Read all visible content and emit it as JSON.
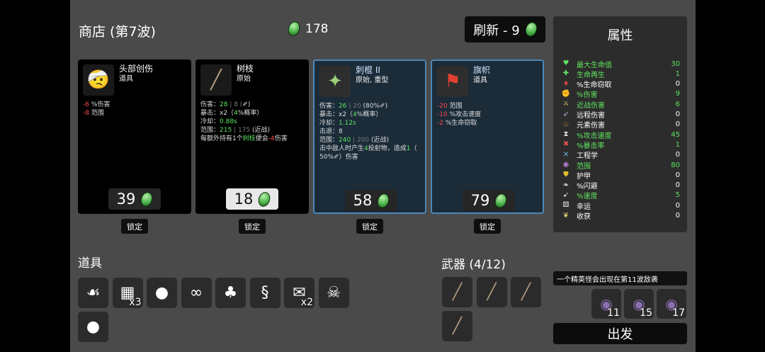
{
  "header": {
    "title": "商店 (第7波)",
    "materials": "178",
    "reroll_label": "刷新 - 9"
  },
  "cards": [
    {
      "name": "头部创伤",
      "type": "道具",
      "icon": "bandaged-head-icon",
      "glyph": "🤕",
      "stats": [
        [
          {
            "t": "-6",
            "c": "neg"
          },
          {
            "t": " %伤害"
          }
        ],
        [
          {
            "t": "-8",
            "c": "neg"
          },
          {
            "t": " 范围"
          }
        ]
      ],
      "price": "39",
      "lock": "锁定"
    },
    {
      "name": "树枝",
      "type": "原始",
      "icon": "branch-icon",
      "glyph": "╱",
      "stats": [
        [
          {
            "t": "伤害："
          },
          {
            "t": "28",
            "c": "pos"
          },
          {
            "t": " | 8 (",
            "c": "dim"
          },
          {
            "t": "✐"
          },
          {
            "t": ")"
          }
        ],
        [
          {
            "t": "暴击：x2（"
          },
          {
            "t": "4",
            "c": "pos"
          },
          {
            "t": "%概率）"
          }
        ],
        [
          {
            "t": "冷却："
          },
          {
            "t": "0.88s",
            "c": "pos"
          }
        ],
        [
          {
            "t": "范围："
          },
          {
            "t": "215",
            "c": "pos"
          },
          {
            "t": " | 175",
            "c": "dim"
          },
          {
            "t": " (近战)"
          }
        ],
        [
          {
            "t": "每额外持有1个"
          },
          {
            "t": "树枝",
            "c": "pos"
          },
          {
            "t": "便会"
          },
          {
            "t": "-4",
            "c": "neg"
          },
          {
            "t": "伤害"
          }
        ]
      ],
      "price": "18",
      "lock": "锁定"
    },
    {
      "name": "刺棍 II",
      "type": "原始, 重型",
      "icon": "spiked-club-icon",
      "glyph": "✦",
      "stats": [
        [
          {
            "t": "伤害："
          },
          {
            "t": "26",
            "c": "pos"
          },
          {
            "t": " | 20",
            "c": "dim"
          },
          {
            "t": " (80%"
          },
          {
            "t": "✐"
          },
          {
            "t": ")"
          }
        ],
        [
          {
            "t": "暴击：x2（"
          },
          {
            "t": "4",
            "c": "pos"
          },
          {
            "t": "%概率）"
          }
        ],
        [
          {
            "t": "冷却："
          },
          {
            "t": "1.12s",
            "c": "pos"
          }
        ],
        [
          {
            "t": "击退："
          },
          {
            "t": "8"
          }
        ],
        [
          {
            "t": "范围："
          },
          {
            "t": "240",
            "c": "pos"
          },
          {
            "t": " | 200",
            "c": "dim"
          },
          {
            "t": " (近战)"
          }
        ],
        [
          {
            "t": "击中敌人时产生"
          },
          {
            "t": "4",
            "c": "pos"
          },
          {
            "t": "投射物，造成"
          },
          {
            "t": "1",
            "c": "pos"
          },
          {
            "t": "（"
          }
        ],
        [
          {
            "t": "50%"
          },
          {
            "t": "✐"
          },
          {
            "t": "）伤害"
          }
        ]
      ],
      "price": "58",
      "lock": "锁定"
    },
    {
      "name": "旗帜",
      "type": "道具",
      "icon": "banner-icon",
      "glyph": "⚑",
      "stats": [
        [
          {
            "t": "-20",
            "c": "neg"
          },
          {
            "t": " 范围"
          }
        ],
        [
          {
            "t": "-10",
            "c": "neg"
          },
          {
            "t": " %攻击速度"
          }
        ],
        [
          {
            "t": "-2",
            "c": "neg"
          },
          {
            "t": " %生命窃取"
          }
        ]
      ],
      "price": "79",
      "lock": "锁定"
    }
  ],
  "stats_panel": {
    "title": "属性",
    "rows": [
      {
        "name": "最大生命值",
        "value": "30",
        "color": "#5ee35e",
        "icon": "heart-icon",
        "glyph": "♥",
        "ic": "#5ee35e"
      },
      {
        "name": "生命再生",
        "value": "1",
        "color": "#5ee35e",
        "icon": "regen-icon",
        "glyph": "✚",
        "ic": "#5ee35e"
      },
      {
        "name": "%生命窃取",
        "value": "0",
        "color": "#ffffff",
        "icon": "lifesteal-icon",
        "glyph": "♦",
        "ic": "#d04040"
      },
      {
        "name": "%伤害",
        "value": "9",
        "color": "#5ee35e",
        "icon": "damage-icon",
        "glyph": "✊",
        "ic": "#e06060"
      },
      {
        "name": "近战伤害",
        "value": "6",
        "color": "#5ee35e",
        "icon": "melee-icon",
        "glyph": "⚔",
        "ic": "#e0c070"
      },
      {
        "name": "远程伤害",
        "value": "0",
        "color": "#ffffff",
        "icon": "ranged-icon",
        "glyph": "➶",
        "ic": "#d0b0e0"
      },
      {
        "name": "元素伤害",
        "value": "0",
        "color": "#ffffff",
        "icon": "elemental-icon",
        "glyph": "♨",
        "ic": "#f0a050"
      },
      {
        "name": "%攻击速度",
        "value": "45",
        "color": "#5ee35e",
        "icon": "attack-speed-icon",
        "glyph": "⧗",
        "ic": "#e0e0e0"
      },
      {
        "name": "%暴击率",
        "value": "1",
        "color": "#5ee35e",
        "icon": "crit-icon",
        "glyph": "✖",
        "ic": "#e05050"
      },
      {
        "name": "工程学",
        "value": "0",
        "color": "#ffffff",
        "icon": "engineering-icon",
        "glyph": "✕",
        "ic": "#70b0e0"
      },
      {
        "name": "范围",
        "value": "80",
        "color": "#5ee35e",
        "icon": "range-icon",
        "glyph": "◉",
        "ic": "#c080e0"
      },
      {
        "name": "护甲",
        "value": "0",
        "color": "#ffffff",
        "icon": "armor-icon",
        "glyph": "⛊",
        "ic": "#e0c030"
      },
      {
        "name": "%闪避",
        "value": "0",
        "color": "#ffffff",
        "icon": "dodge-icon",
        "glyph": "❧",
        "ic": "#e0e0e0"
      },
      {
        "name": "%速度",
        "value": "5",
        "color": "#5ee35e",
        "icon": "speed-icon",
        "glyph": "➹",
        "ic": "#e0e0e0"
      },
      {
        "name": "幸运",
        "value": "0",
        "color": "#ffffff",
        "icon": "luck-icon",
        "glyph": "⚄",
        "ic": "#ffffff"
      },
      {
        "name": "收获",
        "value": "0",
        "color": "#ffffff",
        "icon": "harvest-icon",
        "glyph": "❦",
        "ic": "#e0d070"
      }
    ]
  },
  "items_section": {
    "label": "道具",
    "items": [
      {
        "icon": "ghost-hook-icon",
        "glyph": "☙",
        "count": ""
      },
      {
        "icon": "treasure-map-icon",
        "glyph": "▦",
        "count": "x3"
      },
      {
        "icon": "poop-icon",
        "glyph": "●",
        "count": ""
      },
      {
        "icon": "glasses-icon",
        "glyph": "∞",
        "count": ""
      },
      {
        "icon": "palm-tree-icon",
        "glyph": "♣",
        "count": ""
      },
      {
        "icon": "snake-icon",
        "glyph": "§",
        "count": ""
      },
      {
        "icon": "scroll-icon",
        "glyph": "✉",
        "count": "x2"
      },
      {
        "icon": "horned-skull-icon",
        "glyph": "☠",
        "count": ""
      },
      {
        "icon": "egg-icon",
        "glyph": "●",
        "count": ""
      }
    ]
  },
  "weapons_section": {
    "label": "武器 (4/12)",
    "weapons": [
      {
        "icon": "branch-icon",
        "glyph": "╱"
      },
      {
        "icon": "branch-icon",
        "glyph": "╱"
      },
      {
        "icon": "branch-icon",
        "glyph": "╱"
      },
      {
        "icon": "branch-icon",
        "glyph": "╱"
      }
    ]
  },
  "wave_info": {
    "elite_text": "一个精英怪会出现在第11波敌袭",
    "enemies": [
      {
        "icon": "horned-enemy-icon",
        "glyph": "◉",
        "count": "11"
      },
      {
        "icon": "enemy-group-icon",
        "glyph": "◉",
        "count": "15"
      },
      {
        "icon": "horned-enemy-icon",
        "glyph": "◉",
        "count": "17"
      }
    ],
    "go_label": "出发"
  }
}
